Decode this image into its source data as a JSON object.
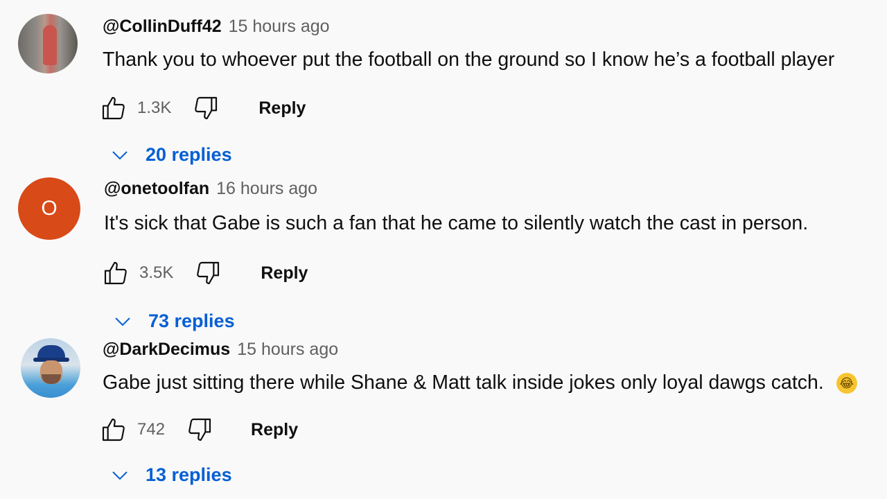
{
  "comments": [
    {
      "author": "@CollinDuff42",
      "time": "15 hours ago",
      "text": "Thank you to whoever put the football on the ground so I know he’s a football player",
      "likes": "1.3K",
      "reply_label": "Reply",
      "replies_label": "20 replies",
      "avatar_icon": "profile-photo"
    },
    {
      "author": "@onetoolfan",
      "time": "16 hours ago",
      "text": "It's sick that Gabe is such a fan that he came to silently watch the cast in person.",
      "likes": "3.5K",
      "reply_label": "Reply",
      "replies_label": "73 replies",
      "avatar_letter": "O",
      "avatar_color": "#d84a17"
    },
    {
      "author": "@DarkDecimus",
      "time": "15 hours ago",
      "text": "Gabe just sitting there while Shane & Matt talk inside jokes only loyal dawgs catch.",
      "emoji": "😂",
      "likes": "742",
      "reply_label": "Reply",
      "replies_label": "13 replies",
      "avatar_icon": "profile-photo"
    }
  ],
  "colors": {
    "background": "#f9f9f9",
    "link_blue": "#065fd4",
    "secondary_text": "#606060"
  },
  "icons": {
    "like": "thumbs-up-icon",
    "dislike": "thumbs-down-icon",
    "expand": "chevron-down-icon"
  }
}
